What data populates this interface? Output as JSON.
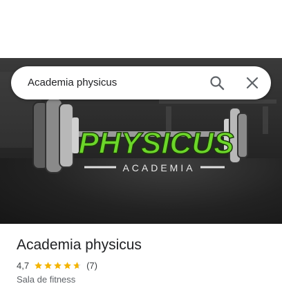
{
  "search": {
    "query": "Academia physicus"
  },
  "hero": {
    "logo_main": "PHYSICUS",
    "logo_sub": "ACADEMIA"
  },
  "place": {
    "name": "Academia physicus",
    "rating_value": "4,7",
    "rating": 4.7,
    "reviews": "(7)",
    "category": "Sala de fitness"
  },
  "colors": {
    "logo_green": "#6cd62a",
    "star_yellow": "#f4b400",
    "text_primary": "#202124"
  }
}
